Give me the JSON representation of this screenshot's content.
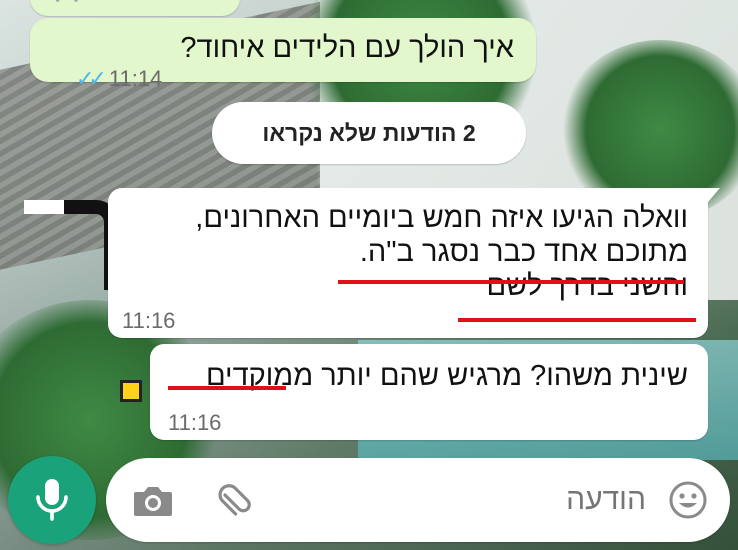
{
  "chat": {
    "messages": [
      {
        "direction": "outgoing",
        "text": "איך הולך עם הלידים איחוד?",
        "time": "11:14",
        "status": "read",
        "status_icon": "double-check-icon",
        "status_color": "#4fb6ec"
      }
    ],
    "unread_banner": "2 הודעות שלא נקראו",
    "incoming": [
      {
        "lines": [
          "וואלה הגיעו איזה חמש ביומיים האחרונים,",
          "מתוכם אחד כבר נסגר ב\"ה.",
          "והשני בדרך לשם"
        ],
        "time": "11:16"
      },
      {
        "lines": [
          "שינית משהו? מרגיש שהם יותר ממוקדים"
        ],
        "time": "11:16"
      }
    ]
  },
  "composer": {
    "placeholder": "הודעה",
    "emoji_icon": "emoji-icon",
    "attach_icon": "paperclip-icon",
    "camera_icon": "camera-icon",
    "mic_icon": "microphone-icon"
  },
  "colors": {
    "outgoing_bubble": "#e2f7cb",
    "incoming_bubble": "#ffffff",
    "accent": "#1aa37a",
    "annotation_underline": "#e0101a"
  }
}
